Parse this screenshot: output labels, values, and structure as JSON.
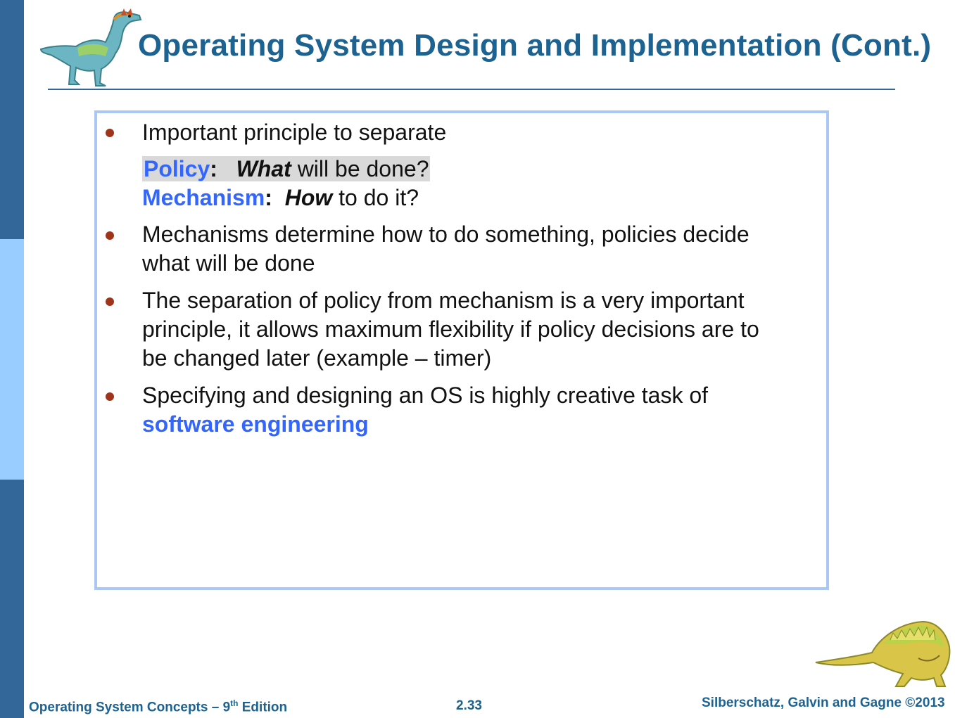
{
  "slide": {
    "title": "Operating System Design and Implementation (Cont.)",
    "bullets": [
      {
        "intro": "Important principle to separate",
        "policy_term": "Policy",
        "colon": ":",
        "policy_em": "What",
        "policy_rest": " will be done?",
        "mechanism_term": "Mechanism",
        "mechanism_em": "How",
        "mechanism_rest": " to do it?"
      },
      {
        "line1": "Mechanisms determine how to do something, policies decide",
        "line2": "what will be done"
      },
      {
        "line1": "The separation of policy from mechanism is a very important",
        "line2": "principle, it allows maximum flexibility if policy decisions are to",
        "line3": "be changed later (example – timer)"
      },
      {
        "line1": "Specifying and designing an OS is highly creative task of",
        "term": "software engineering"
      }
    ]
  },
  "footer": {
    "book": "Operating System Concepts – 9",
    "edition_sup": "th",
    "edition_word": " Edition",
    "page": "2.33",
    "copyright": "Silberschatz, Galvin and Gagne ©2013"
  },
  "colors": {
    "title": "#1d6391",
    "keyword": "#3366ff",
    "bullet": "#a0341b",
    "band_dark": "#336699",
    "band_light": "#99ccff",
    "box_border": "#a9c9f4"
  },
  "icons": [
    "dinosaur-logo-top",
    "dinosaur-logo-bottom"
  ]
}
